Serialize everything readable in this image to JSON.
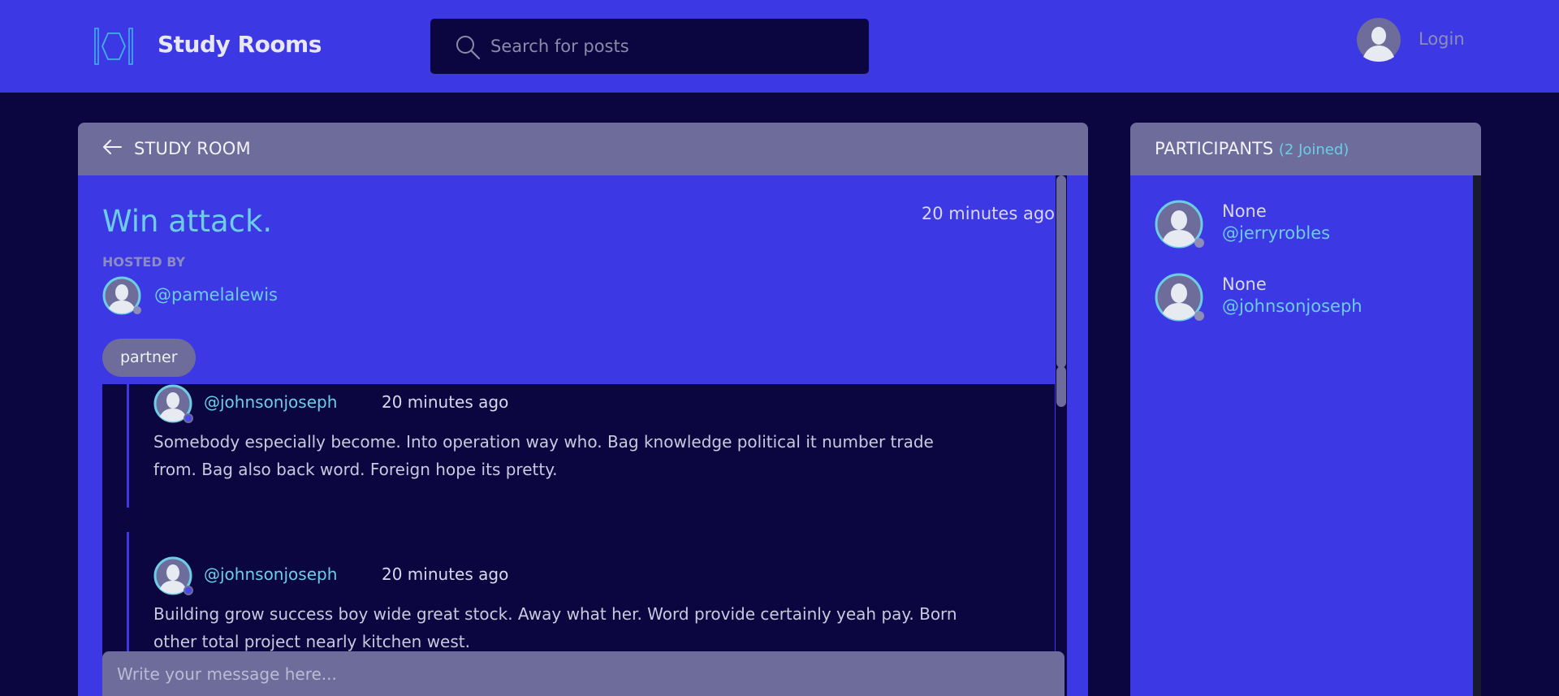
{
  "header": {
    "app_title": "Study Rooms",
    "search_placeholder": "Search for posts",
    "login_label": "Login"
  },
  "room": {
    "header_label": "STUDY ROOM",
    "title": "Win attack.",
    "time": "20 minutes ago",
    "hosted_by_label": "HOSTED BY",
    "host": "@pamelalewis",
    "topic": "partner",
    "composer_placeholder": "Write your message here..."
  },
  "messages": [
    {
      "user": "@johnsonjoseph",
      "time": "20 minutes ago",
      "body": "Somebody especially become. Into operation way who. Bag knowledge political it number trade from. Bag also back word. Foreign hope its pretty."
    },
    {
      "user": "@johnsonjoseph",
      "time": "20 minutes ago",
      "body": "Building grow success boy wide great stock. Away what her. Word provide certainly yeah pay. Born other total project nearly kitchen west."
    }
  ],
  "participants": {
    "title": "PARTICIPANTS",
    "count_label": "(2 Joined)",
    "items": [
      {
        "name": "None",
        "handle": "@jerryrobles"
      },
      {
        "name": "None",
        "handle": "@johnsonjoseph"
      }
    ]
  },
  "colors": {
    "background": "#0b0640",
    "primary": "#3c38e4",
    "panel_header": "#6d6c9a",
    "accent": "#6dcde6"
  }
}
